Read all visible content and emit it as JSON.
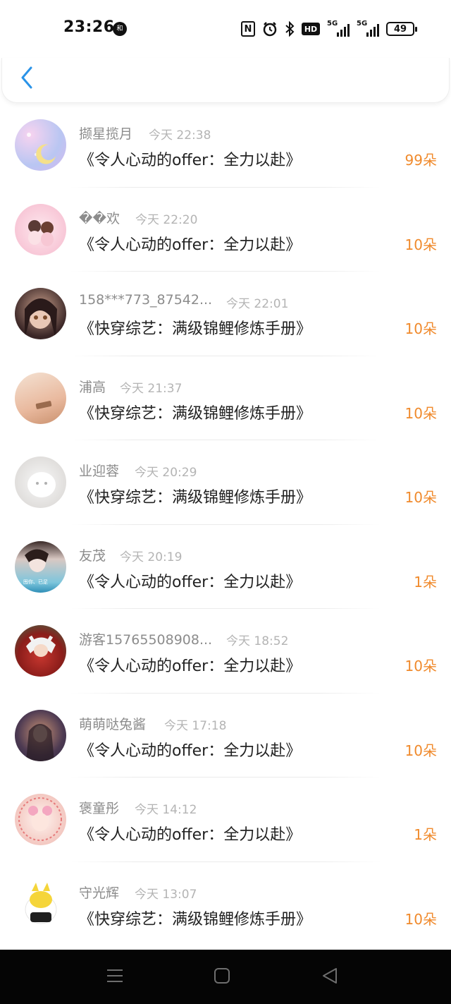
{
  "status_bar": {
    "time": "23:26",
    "notif_badge": "和",
    "battery": "49",
    "signal1_label": "5G",
    "signal2_label": "5G",
    "hd_label": "HD"
  },
  "header": {
    "back_icon": "chevron-left-icon"
  },
  "colors": {
    "accent_blue": "#2a93e8",
    "amount_orange": "#f08a2c"
  },
  "gifts": [
    {
      "name": "撷星揽月",
      "time": "今天 22:38",
      "book": "《令人心动的offer：全力以赴》",
      "amount": "99朵"
    },
    {
      "name": "��欢",
      "time": "今天 22:20",
      "book": "《令人心动的offer：全力以赴》",
      "amount": "10朵"
    },
    {
      "name": "158***773_87542...",
      "time": "今天 22:01",
      "book": "《快穿综艺：满级锦鲤修炼手册》",
      "amount": "10朵"
    },
    {
      "name": "浦高",
      "time": "今天 21:37",
      "book": "《快穿综艺：满级锦鲤修炼手册》",
      "amount": "10朵"
    },
    {
      "name": "业迎蓉",
      "time": "今天 20:29",
      "book": "《快穿综艺：满级锦鲤修炼手册》",
      "amount": "10朵"
    },
    {
      "name": "友茂",
      "time": "今天 20:19",
      "book": "《令人心动的offer：全力以赴》",
      "amount": "1朵"
    },
    {
      "name": "游客15765508908...",
      "time": "今天 18:52",
      "book": "《令人心动的offer：全力以赴》",
      "amount": "10朵"
    },
    {
      "name": "萌萌哒兔酱",
      "time": "今天 17:18",
      "book": "《令人心动的offer：全力以赴》",
      "amount": "10朵"
    },
    {
      "name": "褒童彤",
      "time": "今天 14:12",
      "book": "《令人心动的offer：全力以赴》",
      "amount": "1朵"
    },
    {
      "name": "守光辉",
      "time": "今天 13:07",
      "book": "《快穿综艺：满级锦鲤修炼手册》",
      "amount": "10朵"
    }
  ],
  "avatar_text": {
    "row6": "囤你、已足"
  },
  "navbar": {
    "menu_icon": "menu-icon",
    "home_icon": "home-square-icon",
    "back_icon": "back-triangle-icon"
  }
}
